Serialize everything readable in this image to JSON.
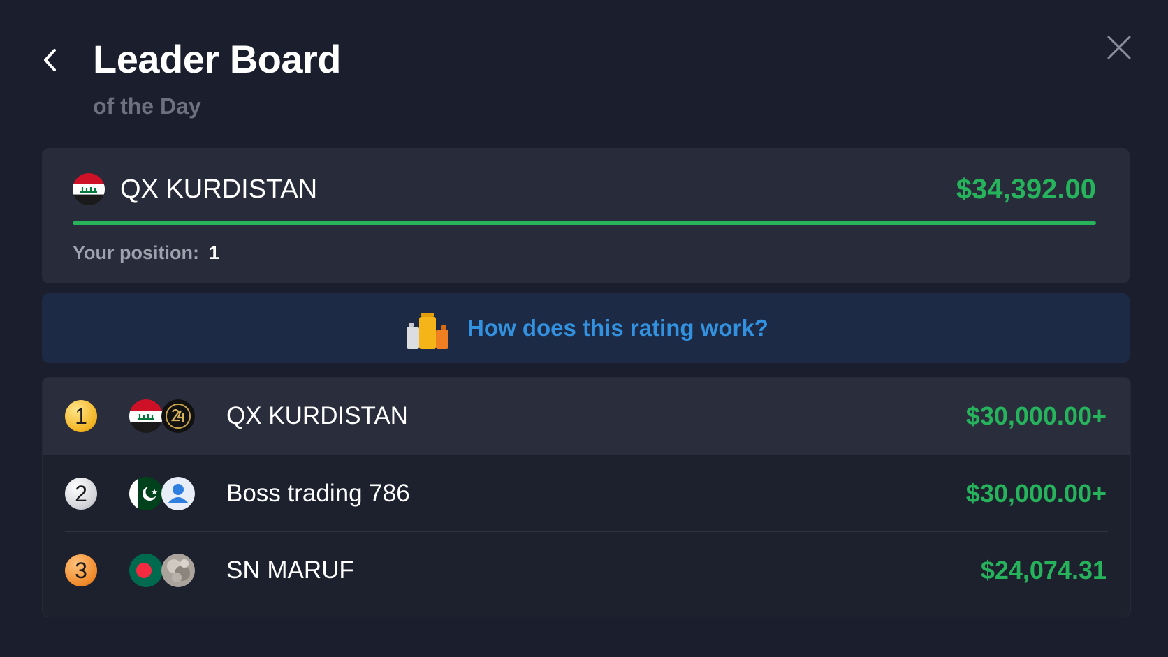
{
  "header": {
    "title": "Leader Board",
    "subtitle": "of the Day",
    "back_icon": "chevron-left-icon",
    "close_icon": "close-icon"
  },
  "my_card": {
    "flag": "iraq-flag",
    "name": "QX KURDISTAN",
    "amount": "$34,392.00",
    "progress_percent": 100,
    "position_label": "Your position:",
    "position_value": "1"
  },
  "info_banner": {
    "icon": "podium-icon",
    "text": "How does this rating work?"
  },
  "leaderboard": {
    "rows": [
      {
        "rank": "1",
        "rank_style": "gold",
        "flag": "iraq-flag",
        "avatar": "logo-avatar",
        "name": "QX KURDISTAN",
        "amount": "$30,000.00+"
      },
      {
        "rank": "2",
        "rank_style": "silver",
        "flag": "pakistan-flag",
        "avatar": "default-user-avatar",
        "name": "Boss trading 786",
        "amount": "$30,000.00+"
      },
      {
        "rank": "3",
        "rank_style": "bronze",
        "flag": "bangladesh-flag",
        "avatar": "photo-avatar",
        "name": "SN MARUF",
        "amount": "$24,074.31"
      }
    ]
  },
  "colors": {
    "background": "#1b1f2d",
    "card": "#272b3a",
    "accent_green": "#26b35c",
    "accent_blue": "#3392e0",
    "banner": "#1c2a45",
    "muted_text": "#6c717f"
  }
}
